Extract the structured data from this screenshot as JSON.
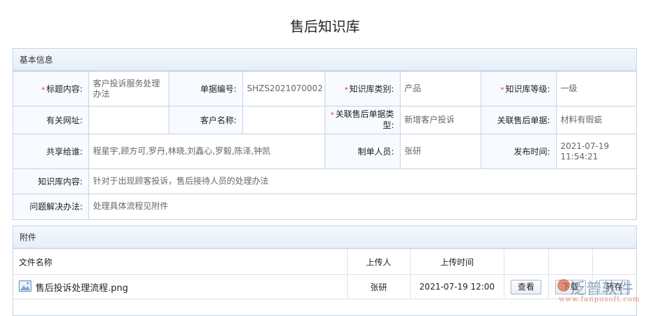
{
  "page": {
    "title": "售后知识库"
  },
  "basic": {
    "header": "基本信息",
    "fields": {
      "title_label": "标题内容:",
      "title_value": "客户投诉服务处理办法",
      "docno_label": "单据编号:",
      "docno_value": "SHZS2021070002",
      "category_label": "知识库类别:",
      "category_value": "产品",
      "level_label": "知识库等级:",
      "level_value": "一级",
      "url_label": "有关网址:",
      "url_value": "",
      "customer_label": "客户名称:",
      "customer_value": "",
      "reltype_label": "关联售后单据类型:",
      "reltype_value": "新增客户投诉",
      "reldoc_label": "关联售后单据:",
      "reldoc_value": "材料有瑕疵",
      "share_label": "共享给谁:",
      "share_value": "程星宇,顾方可,罗丹,林晓,刘鑫心,罗毅,陈泽,钟凯",
      "maker_label": "制单人员:",
      "maker_value": "张研",
      "pubtime_label": "发布时间:",
      "pubtime_value": "2021-07-19 11:54:21",
      "content_label": "知识库内容:",
      "content_value": "针对于出现顾客投诉，售后接待人员的处理办法",
      "solution_label": "问题解决办法:",
      "solution_value": "处理具体流程见附件"
    },
    "required_mark": "*"
  },
  "attachments": {
    "header": "附件",
    "columns": {
      "name": "文件名称",
      "uploader": "上传人",
      "time": "上传时间"
    },
    "rows": [
      {
        "name": "售后投诉处理流程.png",
        "uploader": "张研",
        "time": "2021-07-19 12:00",
        "view": "查看",
        "download": "下载",
        "save": "转存"
      }
    ]
  },
  "watermark": {
    "brand": "泛普软件",
    "url": "www.fanpusoft.com"
  }
}
